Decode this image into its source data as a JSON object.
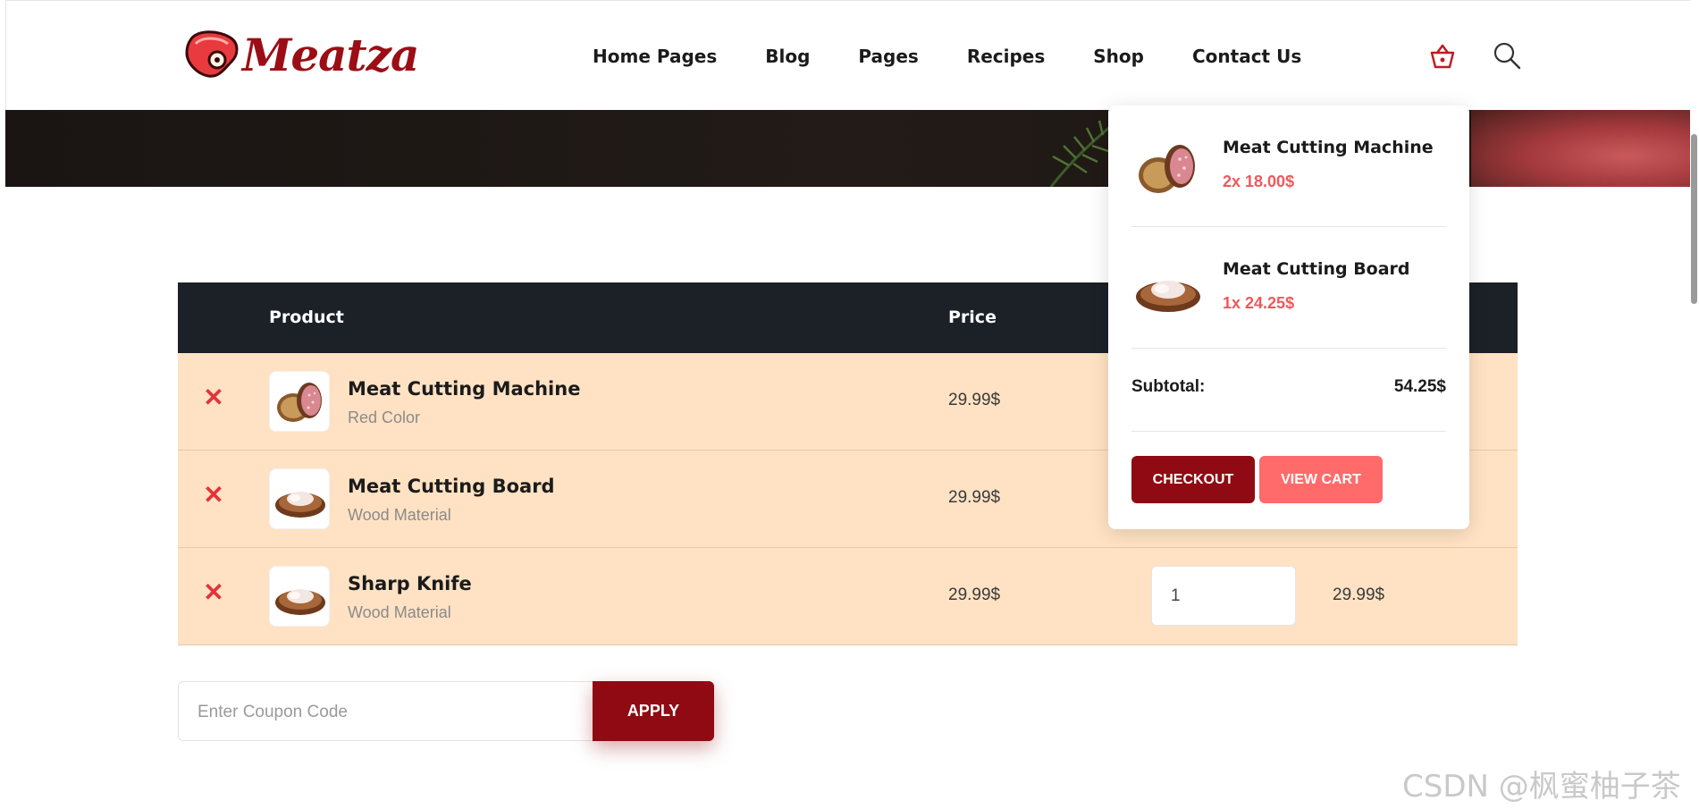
{
  "brand": {
    "name": "Meatza",
    "color": "#9b0e16"
  },
  "nav": {
    "items": [
      "Home Pages",
      "Blog",
      "Pages",
      "Recipes",
      "Shop",
      "Contact Us"
    ]
  },
  "header_icons": [
    "basket-icon",
    "search-icon"
  ],
  "table": {
    "headers": {
      "product": "Product",
      "price": "Price"
    },
    "rows": [
      {
        "name": "Meat Cutting Machine",
        "variant": "Red Color",
        "price": "29.99$",
        "quantity": "",
        "total": "",
        "image": "salami-image"
      },
      {
        "name": "Meat Cutting Board",
        "variant": "Wood Material",
        "price": "29.99$",
        "quantity": "",
        "total": "",
        "image": "meat-board-image"
      },
      {
        "name": "Sharp Knife",
        "variant": "Wood Material",
        "price": "29.99$",
        "quantity": "1",
        "total": "29.99$",
        "image": "meat-board-image"
      }
    ]
  },
  "coupon": {
    "placeholder": "Enter Coupon Code",
    "apply_label": "APPLY"
  },
  "minicart": {
    "items": [
      {
        "name": "Meat Cutting Machine",
        "price": "2x 18.00$",
        "image": "salami-image"
      },
      {
        "name": "Meat Cutting Board",
        "price": "1x 24.25$",
        "image": "meat-board-image"
      }
    ],
    "subtotal_label": "Subtotal:",
    "subtotal_value": "54.25$",
    "checkout_label": "CHECKOUT",
    "viewcart_label": "VIEW CART"
  },
  "watermark": "CSDN @枫蜜柚子茶",
  "colors": {
    "accent": "#8f0a12",
    "coral": "#ff6b6b",
    "row_bg": "#ffe2c3",
    "header_bg": "#1c2027",
    "remove": "#e3333a"
  }
}
